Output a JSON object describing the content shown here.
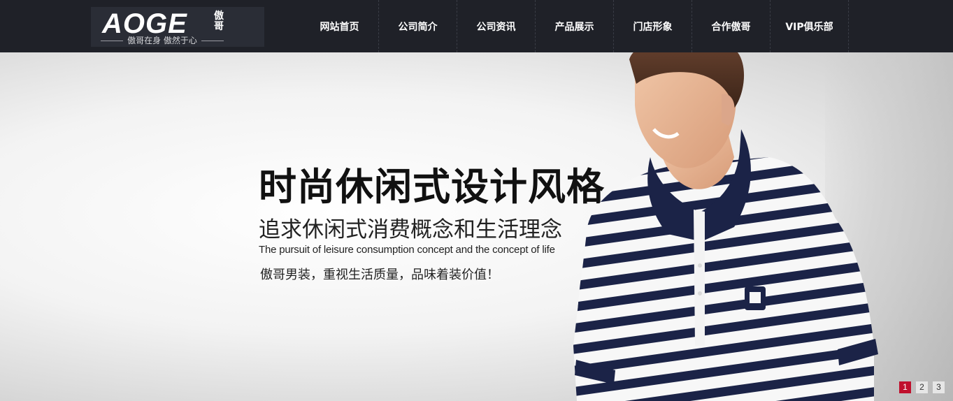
{
  "brand": {
    "logo_text": "AOGE",
    "logo_cn": "傲哥",
    "slogan": "傲哥在身 傲然于心"
  },
  "nav": {
    "items": [
      {
        "label": "网站首页"
      },
      {
        "label": "公司简介"
      },
      {
        "label": "公司资讯"
      },
      {
        "label": "产品展示"
      },
      {
        "label": "门店形象"
      },
      {
        "label": "合作傲哥"
      },
      {
        "label": "VIP俱乐部"
      }
    ]
  },
  "banner": {
    "title": "时尚休闲式设计风格",
    "subtitle": "追求休闲式消费概念和生活理念",
    "english": "The pursuit of leisure consumption concept and the concept of life",
    "tagline": "傲哥男装，重视生活质量，品味着装价值！"
  },
  "pager": {
    "pages": [
      "1",
      "2",
      "3"
    ],
    "active": "1"
  },
  "colors": {
    "header_bg": "#1f2128",
    "pager_active": "#c0102d",
    "shirt_stripe": "#1b2347",
    "collar": "#1b2347"
  }
}
